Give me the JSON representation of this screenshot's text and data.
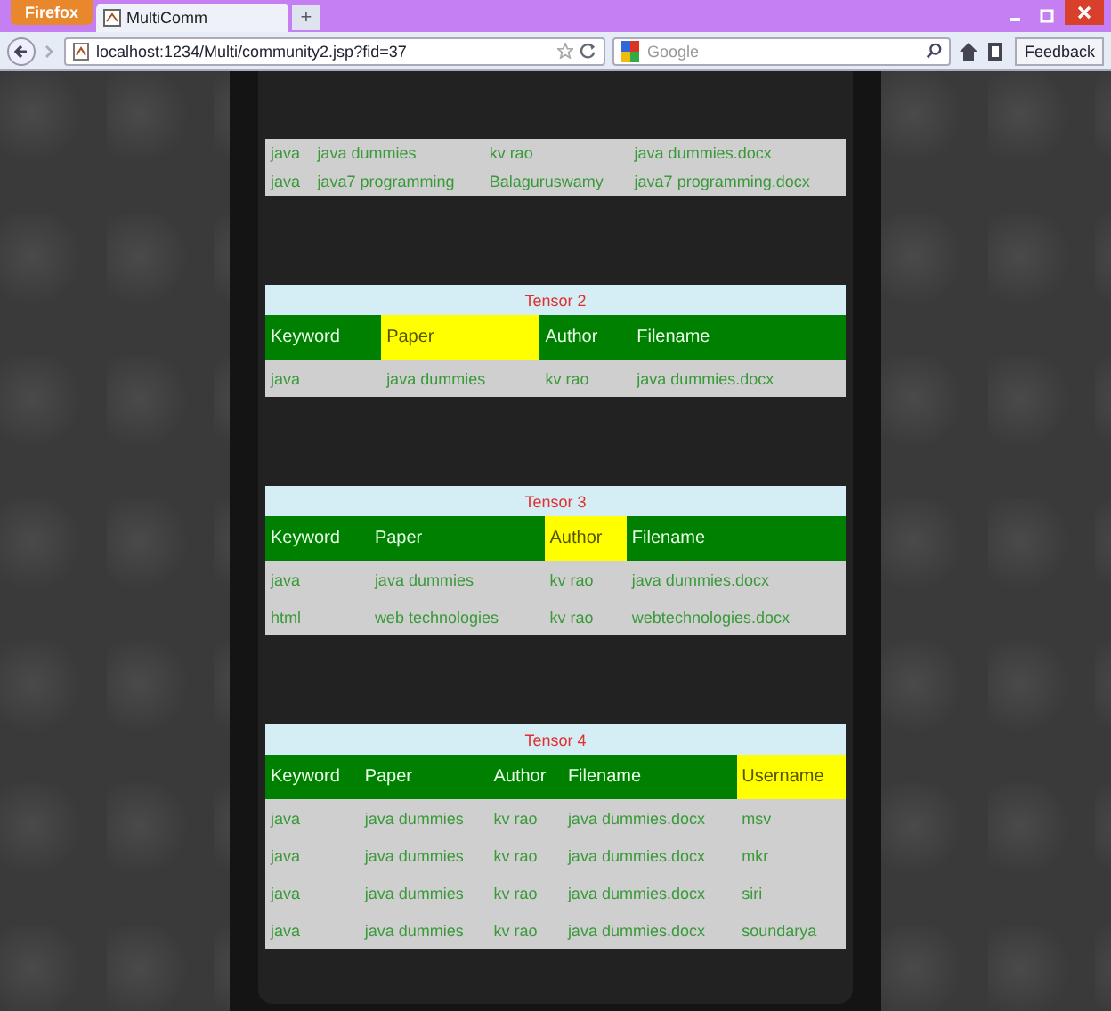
{
  "browser": {
    "menu_button": "Firefox",
    "tab_title": "MultiComm",
    "new_tab": "+",
    "url": "localhost:1234/Multi/community2.jsp?fid=37",
    "search_placeholder": "Google",
    "feedback": "Feedback"
  },
  "tables": [
    {
      "rows": [
        [
          "java",
          "java dummies",
          "kv rao",
          "java dummies.docx"
        ],
        [
          "java",
          "java7 programming",
          "Balaguruswamy",
          "java7 programming.docx"
        ]
      ]
    },
    {
      "title": "Tensor 2",
      "columns": [
        {
          "label": "Keyword",
          "highlighted": false
        },
        {
          "label": "Paper",
          "highlighted": true
        },
        {
          "label": "Author",
          "highlighted": false
        },
        {
          "label": "Filename",
          "highlighted": false
        }
      ],
      "rows": [
        [
          "java",
          "java dummies",
          "kv rao",
          "java dummies.docx"
        ]
      ]
    },
    {
      "title": "Tensor 3",
      "columns": [
        {
          "label": "Keyword",
          "highlighted": false
        },
        {
          "label": "Paper",
          "highlighted": false
        },
        {
          "label": "Author",
          "highlighted": true
        },
        {
          "label": "Filename",
          "highlighted": false
        }
      ],
      "rows": [
        [
          "java",
          "java dummies",
          "kv rao",
          "java dummies.docx"
        ],
        [
          "html",
          "web technologies",
          "kv rao",
          "webtechnologies.docx"
        ]
      ]
    },
    {
      "title": "Tensor 4",
      "columns": [
        {
          "label": "Keyword",
          "highlighted": false
        },
        {
          "label": "Paper",
          "highlighted": false
        },
        {
          "label": "Author",
          "highlighted": false
        },
        {
          "label": "Filename",
          "highlighted": false
        },
        {
          "label": "Username",
          "highlighted": true
        }
      ],
      "rows": [
        [
          "java",
          "java dummies",
          "kv rao",
          "java dummies.docx",
          "msv"
        ],
        [
          "java",
          "java dummies",
          "kv rao",
          "java dummies.docx",
          "mkr"
        ],
        [
          "java",
          "java dummies",
          "kv rao",
          "java dummies.docx",
          "siri"
        ],
        [
          "java",
          "java dummies",
          "kv rao",
          "java dummies.docx",
          "soundarya"
        ]
      ]
    }
  ]
}
